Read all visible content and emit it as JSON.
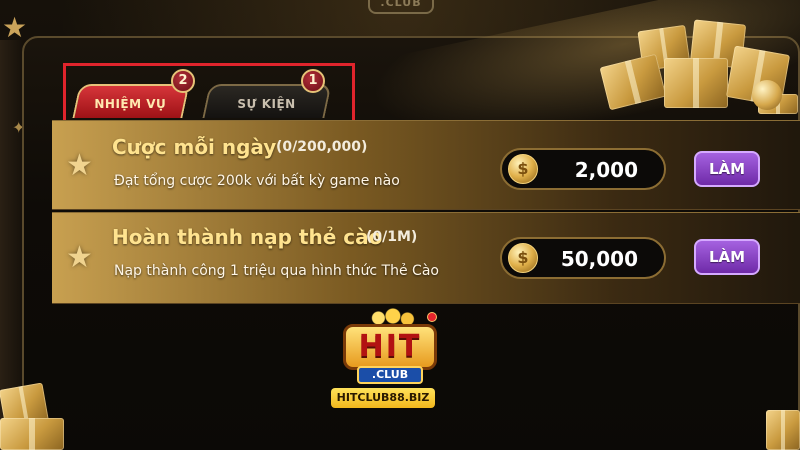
{
  "header": {
    "club_label": ".CLUB"
  },
  "tabs": [
    {
      "label": "NHIỆM VỤ",
      "badge": "2",
      "active": true
    },
    {
      "label": "SỰ KIỆN",
      "badge": "1",
      "active": false
    }
  ],
  "tasks": [
    {
      "title": "Cược mỗi ngày",
      "progress": "(0/200,000)",
      "description": "Đạt tổng cược 200k với bất kỳ game nào",
      "reward": "2,000",
      "action_label": "LÀM"
    },
    {
      "title": "Hoàn thành nạp thẻ cào",
      "progress": "(0/1M)",
      "description": "Nạp thành công 1 triệu qua hình thức Thẻ Cào",
      "reward": "50,000",
      "action_label": "LÀM"
    }
  ],
  "watermark": {
    "logo_text": "HIT",
    "logo_sub": ".CLUB",
    "domain": "HITCLUB88.BIZ"
  },
  "colors": {
    "accent_gold": "#ffe38f",
    "tab_active": "#c2262c",
    "button_purple": "#8a45c8",
    "highlight_red": "#e0242c"
  },
  "icons": [
    "star-icon",
    "coin-icon",
    "gift-box-icon"
  ]
}
